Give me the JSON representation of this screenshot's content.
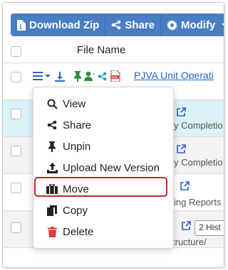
{
  "toolbar": {
    "download_label": "Download Zip",
    "share_label": "Share",
    "modify_label": "Modify"
  },
  "table": {
    "column_title": "File Name",
    "first_row": {
      "file_link": "PJVA Unit Operati"
    },
    "background_fragments": {
      "row2": "y Completio",
      "row4": "ing Reports",
      "row5_badge": "2 Hist",
      "row5_path": "tructure/"
    }
  },
  "context_menu": {
    "items": [
      {
        "label": "View",
        "icon": "search-icon"
      },
      {
        "label": "Share",
        "icon": "share-icon"
      },
      {
        "label": "Unpin",
        "icon": "pin-icon"
      },
      {
        "label": "Upload New Version",
        "icon": "upload-icon"
      },
      {
        "label": "Move",
        "icon": "briefcase-icon"
      },
      {
        "label": "Copy",
        "icon": "copy-icon"
      },
      {
        "label": "Delete",
        "icon": "trash-icon"
      }
    ]
  },
  "colors": {
    "toolbar": "#4a7ec2",
    "highlight": "#c62828",
    "delete": "#e53935",
    "link": "#2b63c5",
    "pin_green": "#2e8b3c",
    "selected_row": "#d9f2f8"
  }
}
